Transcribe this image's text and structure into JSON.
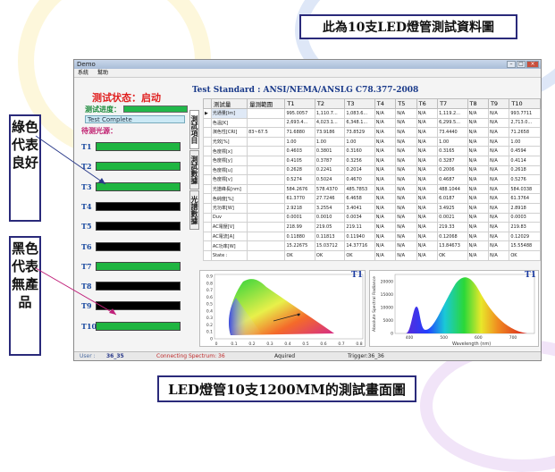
{
  "slide": {
    "title": "此為10支LED燈管測試資料圖",
    "caption": "LED燈管10支1200MM的測試畫面圖",
    "note_green": "綠色代表良好",
    "note_black": "黑色代表無產品"
  },
  "window": {
    "title": "Demo",
    "menu": [
      "系統",
      "幫助"
    ]
  },
  "left": {
    "status": "测试状态：启动",
    "progress_label": "测试进度：",
    "progress": 1.0,
    "complete_text": "Test Complete",
    "pending_label": "待测光源：",
    "tubes": [
      {
        "label": "T1",
        "state": "good"
      },
      {
        "label": "T2",
        "state": "good"
      },
      {
        "label": "T3",
        "state": "good"
      },
      {
        "label": "T4",
        "state": "none"
      },
      {
        "label": "T5",
        "state": "none"
      },
      {
        "label": "T6",
        "state": "none"
      },
      {
        "label": "T7",
        "state": "good"
      },
      {
        "label": "T8",
        "state": "none"
      },
      {
        "label": "T9",
        "state": "none"
      },
      {
        "label": "T10",
        "state": "good"
      }
    ],
    "tabs": [
      "測試項目",
      "測試數據",
      "光譜數據"
    ]
  },
  "standard": "Test Standard : ANSI/NEMA/ANSLG C78.377-2008",
  "table": {
    "headers": [
      "",
      "测試量",
      "量測範圍",
      "T1",
      "T2",
      "T3",
      "T4",
      "T5",
      "T6",
      "T7",
      "T8",
      "T9",
      "T10"
    ],
    "rows": [
      [
        "▶",
        "光通量[lm]",
        "",
        "995.0057",
        "1,110.7...",
        "1,083.6...",
        "N/A",
        "N/A",
        "N/A",
        "1,119.2...",
        "N/A",
        "N/A",
        "993.7711"
      ],
      [
        "",
        "色溫[K]",
        "",
        "2,693.4...",
        "4,023.1...",
        "6,348.1...",
        "N/A",
        "N/A",
        "N/A",
        "6,299.5...",
        "N/A",
        "N/A",
        "2,713.0..."
      ],
      [
        "",
        "演色性[CRI]",
        "83~67.5",
        "71.6880",
        "73.9186",
        "73.8529",
        "N/A",
        "N/A",
        "N/A",
        "73.4440",
        "N/A",
        "N/A",
        "71.2658"
      ],
      [
        "",
        "光效[%]",
        "",
        "1.00",
        "1.00",
        "1.00",
        "N/A",
        "N/A",
        "N/A",
        "1.00",
        "N/A",
        "N/A",
        "1.00"
      ],
      [
        "",
        "色度標[x]",
        "",
        "0.4603",
        "0.3801",
        "0.3160",
        "N/A",
        "N/A",
        "N/A",
        "0.3165",
        "N/A",
        "N/A",
        "0.4594"
      ],
      [
        "",
        "色度標[y]",
        "",
        "0.4105",
        "0.3787",
        "0.3256",
        "N/A",
        "N/A",
        "N/A",
        "0.3287",
        "N/A",
        "N/A",
        "0.4114"
      ],
      [
        "",
        "色度標[u]",
        "",
        "0.2628",
        "0.2241",
        "0.2014",
        "N/A",
        "N/A",
        "N/A",
        "0.2006",
        "N/A",
        "N/A",
        "0.2618"
      ],
      [
        "",
        "色度標[v]",
        "",
        "0.5274",
        "0.5024",
        "0.4670",
        "N/A",
        "N/A",
        "N/A",
        "0.4687",
        "N/A",
        "N/A",
        "0.5276"
      ],
      [
        "",
        "光譜峰長[nm]",
        "",
        "584.2676",
        "578.4370",
        "485.7853",
        "N/A",
        "N/A",
        "N/A",
        "488.1044",
        "N/A",
        "N/A",
        "584.0338"
      ],
      [
        "",
        "色純度[%]",
        "",
        "61.3770",
        "27.7246",
        "6.4658",
        "N/A",
        "N/A",
        "N/A",
        "6.0187",
        "N/A",
        "N/A",
        "61.3764"
      ],
      [
        "",
        "光功率[W]",
        "",
        "2.9218",
        "3.2554",
        "3.4041",
        "N/A",
        "N/A",
        "N/A",
        "3.4925",
        "N/A",
        "N/A",
        "2.8918"
      ],
      [
        "",
        "Duv",
        "",
        "0.0001",
        "0.0010",
        "0.0034",
        "N/A",
        "N/A",
        "N/A",
        "0.0021",
        "N/A",
        "N/A",
        "0.0003"
      ],
      [
        "",
        "AC電壓[V]",
        "",
        "218.99",
        "219.05",
        "219.11",
        "N/A",
        "N/A",
        "N/A",
        "219.33",
        "N/A",
        "N/A",
        "219.83"
      ],
      [
        "",
        "AC電流[A]",
        "",
        "0.11880",
        "0.11813",
        "0.11940",
        "N/A",
        "N/A",
        "N/A",
        "0.12068",
        "N/A",
        "N/A",
        "0.12029"
      ],
      [
        "",
        "AC功率[W]",
        "",
        "15.22675",
        "15.03712",
        "14.37716",
        "N/A",
        "N/A",
        "N/A",
        "13.84673",
        "N/A",
        "N/A",
        "15.55488"
      ],
      [
        "",
        "State :",
        "",
        "OK",
        "OK",
        "OK",
        "N/A",
        "N/A",
        "N/A",
        "OK",
        "N/A",
        "N/A",
        "OK"
      ]
    ]
  },
  "cie_chart": {
    "label": "T1",
    "y_ticks": [
      "0.9",
      "0.8",
      "0.7",
      "0.6",
      "0.5",
      "0.4",
      "0.3",
      "0.2",
      "0.1",
      "0"
    ],
    "x_ticks": [
      "0",
      "0.1",
      "0.2",
      "0.3",
      "0.4",
      "0.5",
      "0.6",
      "0.7",
      "0.8"
    ]
  },
  "spectrum_chart": {
    "label": "T1",
    "ylabel": "Absolute Spectral Radiance",
    "xlabel": "Wavelength (nm)",
    "y_ticks": [
      "20000",
      "15000",
      "10000",
      "5000",
      "0"
    ],
    "x_ticks": [
      "400",
      "500",
      "600",
      "700"
    ]
  },
  "statusbar": {
    "user": "User :",
    "user_value": "36_35",
    "connecting": "Connecting Spectrum: 36",
    "aquired": "Aquired",
    "trigger": "Trigger:36_36"
  },
  "colors": {
    "good": "#1fb541",
    "none": "#000000",
    "accent": "#1a3a8a"
  }
}
